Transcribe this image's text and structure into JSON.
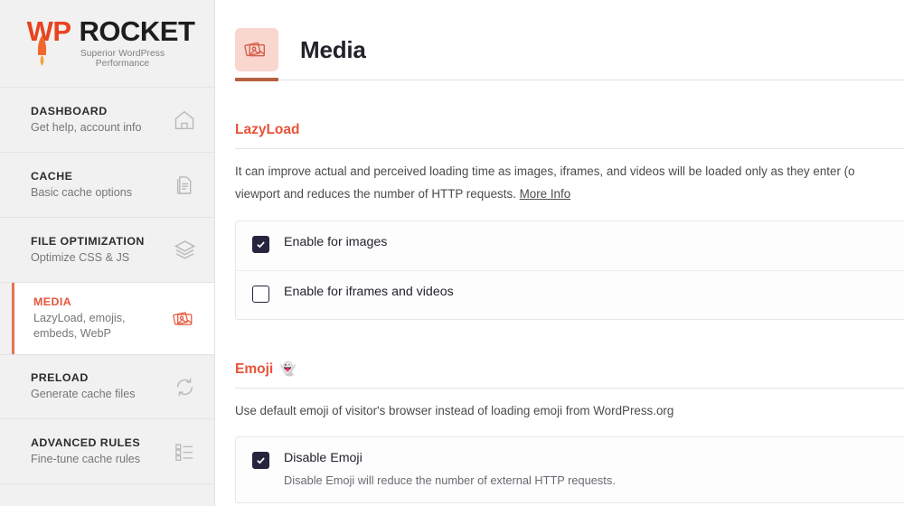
{
  "brand": {
    "name_wp": "WP",
    "name_rocket": "ROCKET",
    "tagline": "Superior WordPress Performance",
    "accent_orange": "#e8431f",
    "accent_salmon": "#e8533a"
  },
  "sidebar": {
    "items": [
      {
        "title": "DASHBOARD",
        "desc": "Get help, account info",
        "icon": "home-icon",
        "active": false
      },
      {
        "title": "CACHE",
        "desc": "Basic cache options",
        "icon": "document-icon",
        "active": false
      },
      {
        "title": "FILE OPTIMIZATION",
        "desc": "Optimize CSS & JS",
        "icon": "layers-icon",
        "active": false
      },
      {
        "title": "MEDIA",
        "desc": "LazyLoad, emojis, embeds, WebP",
        "icon": "photos-icon",
        "active": true
      },
      {
        "title": "PRELOAD",
        "desc": "Generate cache files",
        "icon": "refresh-icon",
        "active": false
      },
      {
        "title": "ADVANCED RULES",
        "desc": "Fine-tune cache rules",
        "icon": "checklist-icon",
        "active": false
      }
    ]
  },
  "header": {
    "title": "Media",
    "icon": "photos-icon",
    "icon_bg": "#f9d6ce"
  },
  "sections": [
    {
      "title": "LazyLoad",
      "emoji": "",
      "description_line1": "It can improve actual and perceived loading time as images, iframes, and videos will be loaded only as they enter (o",
      "description_line2": "viewport and reduces the number of HTTP requests.",
      "more_info_label": "More Info",
      "options": [
        {
          "label": "Enable for images",
          "checked": true,
          "sub": ""
        },
        {
          "label": "Enable for iframes and videos",
          "checked": false,
          "sub": ""
        }
      ]
    },
    {
      "title": "Emoji",
      "emoji": "👻",
      "description_line1": "Use default emoji of visitor's browser instead of loading emoji from WordPress.org",
      "description_line2": "",
      "more_info_label": "",
      "options": [
        {
          "label": "Disable Emoji",
          "checked": true,
          "sub": "Disable Emoji will reduce the number of external HTTP requests."
        }
      ]
    }
  ]
}
